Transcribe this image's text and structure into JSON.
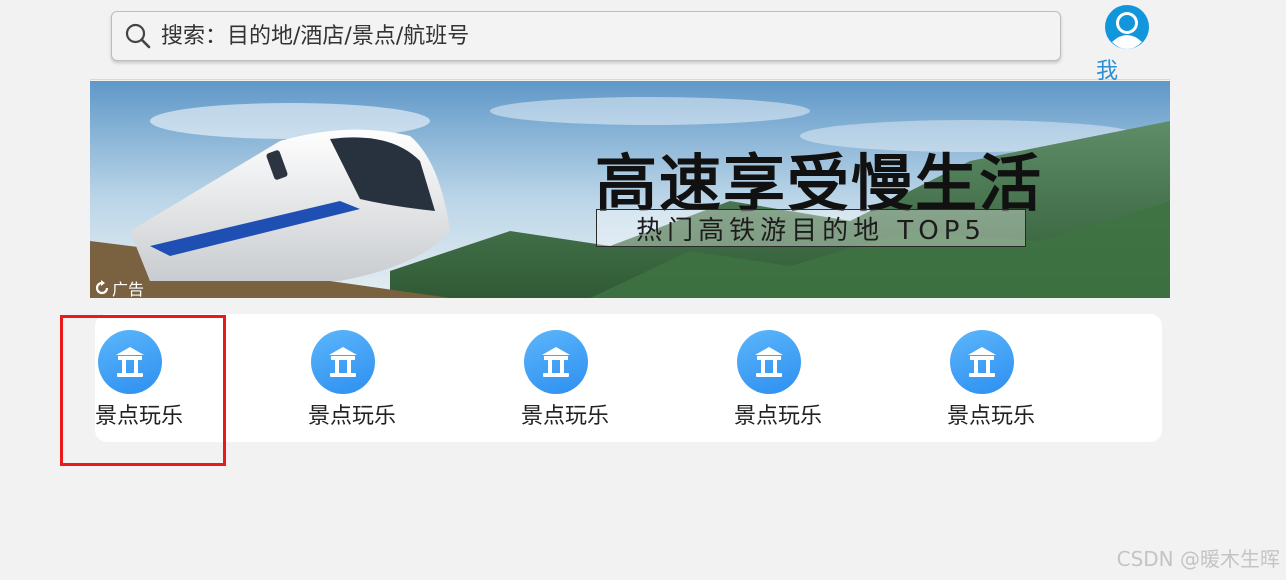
{
  "search": {
    "placeholder": "搜索：目的地/酒店/景点/航班号",
    "icon": "search-icon"
  },
  "mine": {
    "label": "我 的",
    "icon": "user-avatar-icon",
    "color": "#2b8fd6"
  },
  "banner": {
    "title": "高速享受慢生活",
    "subtitle": "热门高铁游目的地 TOP5",
    "ad_label": "广告"
  },
  "categories": [
    {
      "label": "景点玩乐",
      "icon": "gate-icon"
    },
    {
      "label": "景点玩乐",
      "icon": "gate-icon"
    },
    {
      "label": "景点玩乐",
      "icon": "gate-icon"
    },
    {
      "label": "景点玩乐",
      "icon": "gate-icon"
    },
    {
      "label": "景点玩乐",
      "icon": "gate-icon"
    }
  ],
  "colors": {
    "icon_gradient_start": "#5cb6fb",
    "icon_gradient_end": "#2d8ff0",
    "highlight": "#ea1a1a"
  },
  "watermark": "CSDN @暖木生晖"
}
